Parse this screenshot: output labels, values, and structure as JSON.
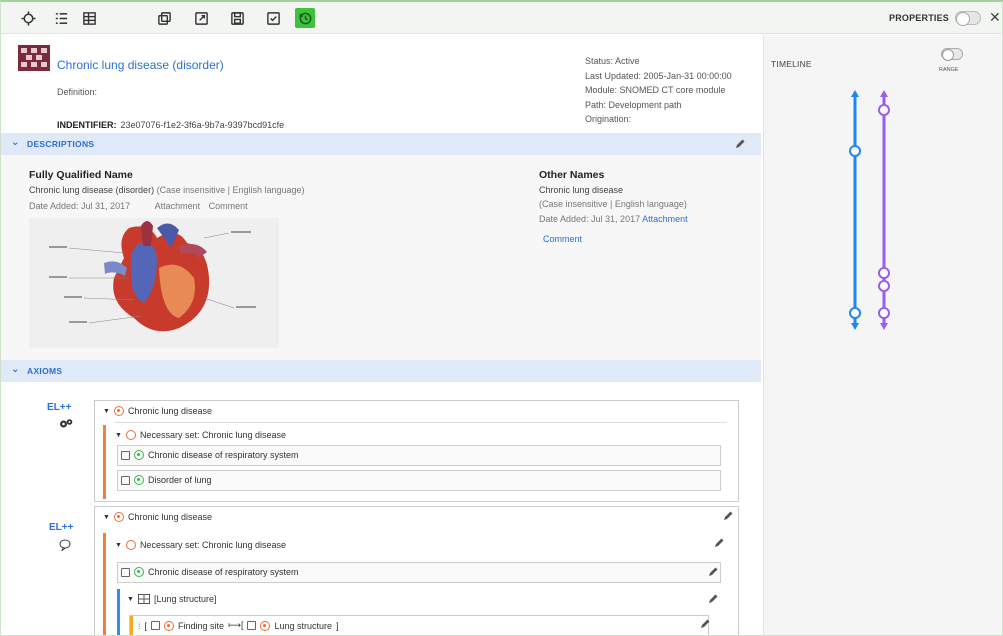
{
  "toolbar": {
    "properties_label": "PROPERTIES",
    "close_glyph": "✕"
  },
  "concept": {
    "title": "Chronic lung disease (disorder)",
    "definition_label": "Definition:",
    "identifier_label": "INDENTIFIER:",
    "identifier_value": "23e07076-f1e2-3f6a-9b7a-9397bcd91cfe",
    "status": "Status: Active",
    "last_updated": "Last Updated: 2005-Jan-31 00:00:00",
    "module": "Module: SNOMED CT core module",
    "path": "Path: Development path",
    "origination": "Origination:"
  },
  "descriptions": {
    "section_label": "DESCRIPTIONS",
    "fqn_heading": "Fully Qualified Name",
    "fqn_text": "Chronic lung disease (disorder)",
    "fqn_meta": "(Case insensitive | English language)",
    "fqn_date": "Date Added:   Jul 31, 2017",
    "fqn_attachment": "Attachment",
    "fqn_comment": "Comment",
    "other_heading": "Other Names",
    "other_text": "Chronic lung disease",
    "other_meta": "(Case insensitive | English language)",
    "other_date": "Date Added: Jul 31, 2017",
    "other_attachment": "Attachment",
    "other_comment": "Comment"
  },
  "axioms": {
    "section_label": "AXIOMS",
    "blocks": [
      {
        "el_label": "EL++",
        "root": "Chronic lung disease",
        "set": "Necessary set: Chronic lung disease",
        "items": [
          "Chronic disease of respiratory system",
          "Disorder of lung"
        ]
      },
      {
        "el_label": "EL++",
        "root": "Chronic lung disease",
        "set": "Necessary set: Chronic lung disease",
        "items": [
          "Chronic disease of respiratory system"
        ],
        "group": "[Lung structure]",
        "role_open": "[",
        "role_name": "Finding site",
        "role_arrow": "⟼[",
        "role_value": "Lung structure",
        "role_close": "]"
      }
    ]
  },
  "timeline": {
    "label": "TIMELINE",
    "range_label": "RANGE",
    "colors": {
      "blue": "#1e88f0",
      "purple": "#9b5cf0"
    }
  }
}
